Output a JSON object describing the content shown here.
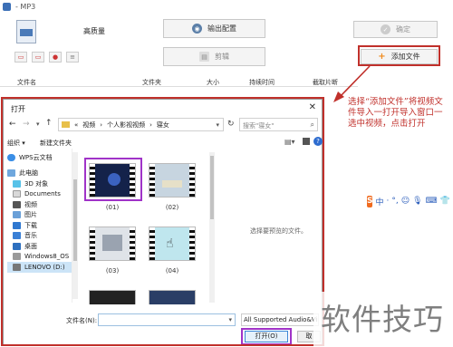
{
  "window": {
    "title": "- MP3"
  },
  "toolbar": {
    "quality_label": "高质量",
    "output_config_label": "输出配置",
    "ok_label": "确定",
    "clip_label": "剪辑",
    "add_file_label": "添加文件"
  },
  "file_table": {
    "columns": [
      "文件名",
      "文件夹",
      "大小",
      "持续时间",
      "截取片断"
    ]
  },
  "dialog": {
    "title": "打开",
    "breadcrumb": [
      "«",
      "视频",
      "个人影视视频",
      "寝女"
    ],
    "search_placeholder": "搜索\"寝女\"",
    "organize_label": "组织 ▾",
    "new_folder_label": "新建文件夹",
    "tree": [
      "WPS云文档",
      "此电脑",
      "3D 对象",
      "Documents",
      "视频",
      "图片",
      "下载",
      "音乐",
      "桌面",
      "Windows8_OS",
      "LENOVO (D:)"
    ],
    "files": [
      "(01)",
      "(02)",
      "(03)",
      "(04)"
    ],
    "preview_hint": "选择要预览的文件。",
    "filename_label": "文件名(N):",
    "filetype_value": "All Supported Audio&Vi",
    "open_label": "打开(O)",
    "cancel_label": "取"
  },
  "annotation": {
    "text": "选择“添加文件”将视频文件导入一打开导入窗口一选中视频，点击打开",
    "color": "#c0302b"
  },
  "ime": {
    "items": [
      "S",
      "中",
      "·",
      "°,",
      "☺",
      "🎙",
      "⌨",
      "👕",
      "⊞"
    ]
  },
  "watermark": "软件技巧"
}
